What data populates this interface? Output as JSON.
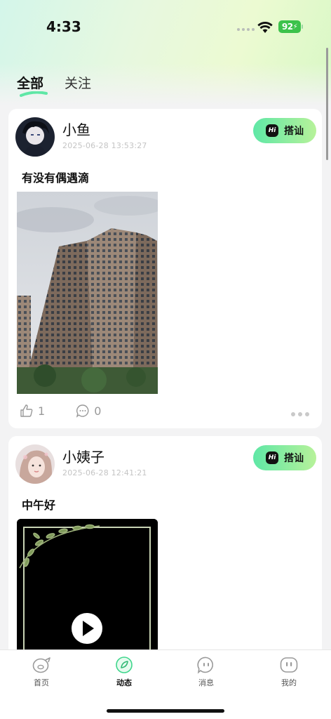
{
  "status_bar": {
    "time": "4:33",
    "battery": "92"
  },
  "tabs": [
    {
      "label": "全部",
      "active": true
    },
    {
      "label": "关注",
      "active": false
    }
  ],
  "posts": [
    {
      "username": "小鱼",
      "timestamp": "2025-06-28 13:53:27",
      "greet_label": "搭讪",
      "hi_text": "Hi",
      "text": "有没有偶遇滴",
      "likes": "1",
      "comments": "0"
    },
    {
      "username": "小姨子",
      "timestamp": "2025-06-28 12:41:21",
      "greet_label": "搭讪",
      "hi_text": "Hi",
      "text": "中午好"
    }
  ],
  "nav": [
    {
      "label": "首页",
      "icon": "pig-face-icon",
      "active": false
    },
    {
      "label": "动态",
      "icon": "compass-leaf-icon",
      "active": true
    },
    {
      "label": "消息",
      "icon": "chat-face-icon",
      "active": false
    },
    {
      "label": "我的",
      "icon": "profile-face-icon",
      "active": false
    }
  ],
  "colors": {
    "accent_green": "#5fe7a6",
    "accent_light_green": "#b7f29a",
    "battery_green": "#3cc24b"
  }
}
